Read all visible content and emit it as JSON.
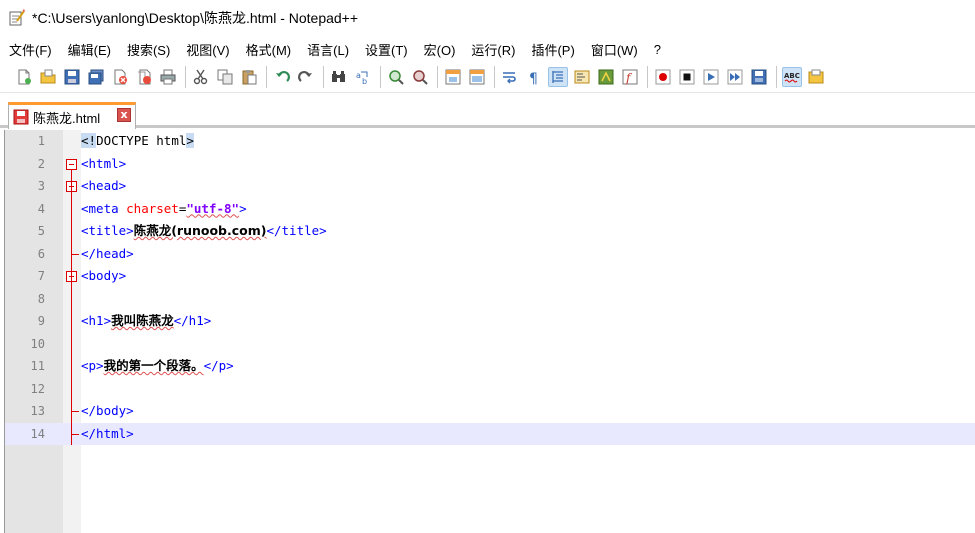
{
  "window": {
    "title": "*C:\\Users\\yanlong\\Desktop\\陈燕龙.html - Notepad++"
  },
  "menu": [
    "文件(F)",
    "编辑(E)",
    "搜索(S)",
    "视图(V)",
    "格式(M)",
    "语言(L)",
    "设置(T)",
    "宏(O)",
    "运行(R)",
    "插件(P)",
    "窗口(W)",
    "?"
  ],
  "toolbar": {
    "icons": [
      "new-file-icon",
      "open-file-icon",
      "save-icon",
      "save-all-icon",
      "close-icon",
      "close-all-icon",
      "print-icon",
      "cut-icon",
      "copy-icon",
      "paste-icon",
      "undo-icon",
      "redo-icon",
      "find-icon",
      "replace-icon",
      "zoom-in-icon",
      "zoom-out-icon",
      "sync-vertical-icon",
      "sync-horizontal-icon",
      "word-wrap-icon",
      "show-all-chars-icon",
      "indent-guide-icon",
      "document-map-icon",
      "function-list-icon",
      "folder-workspace-icon",
      "record-macro-icon",
      "stop-record-icon",
      "play-macro-icon",
      "run-macro-multiple-icon",
      "save-macro-icon",
      "spell-check-icon",
      "extra-icon"
    ],
    "abc_label": "ABC"
  },
  "tab": {
    "label": "陈燕龙.html",
    "close": "x"
  },
  "editor": {
    "lines": [
      {
        "n": "1",
        "parts": [
          [
            "hl",
            "<"
          ],
          [
            "hl-dt",
            "!"
          ],
          [
            "dt",
            "DOCTYPE html"
          ],
          [
            "hl",
            ">"
          ]
        ]
      },
      {
        "n": "2",
        "parts": [
          [
            "tag",
            "<html>"
          ]
        ]
      },
      {
        "n": "3",
        "parts": [
          [
            "tag",
            "<head>"
          ]
        ]
      },
      {
        "n": "4",
        "parts": [
          [
            "tag",
            "<meta "
          ],
          [
            "attr",
            "charset"
          ],
          [
            "dt",
            "="
          ],
          [
            "val",
            "\"utf-8\""
          ],
          [
            "tag",
            ">"
          ]
        ]
      },
      {
        "n": "5",
        "parts": [
          [
            "tag",
            "<title>"
          ],
          [
            "txt",
            "陈燕龙(runoob.com)"
          ],
          [
            "tag",
            "</title>"
          ]
        ]
      },
      {
        "n": "6",
        "parts": [
          [
            "tag",
            "</head>"
          ]
        ]
      },
      {
        "n": "7",
        "parts": [
          [
            "tag",
            "<body>"
          ]
        ]
      },
      {
        "n": "8",
        "parts": []
      },
      {
        "n": "9",
        "parts": [
          [
            "tag",
            "<h1>"
          ],
          [
            "txt",
            "我叫陈燕龙"
          ],
          [
            "tag",
            "</h1>"
          ]
        ]
      },
      {
        "n": "10",
        "parts": []
      },
      {
        "n": "11",
        "parts": [
          [
            "tag",
            "<p>"
          ],
          [
            "txt",
            "我的第一个段落。"
          ],
          [
            "tag",
            "</p>"
          ]
        ]
      },
      {
        "n": "12",
        "parts": []
      },
      {
        "n": "13",
        "parts": [
          [
            "tag",
            "</body>"
          ]
        ]
      },
      {
        "n": "14",
        "parts": [
          [
            "tag",
            "</html>"
          ]
        ]
      }
    ],
    "current_line": 14
  },
  "colors": {
    "tag": "#0000ff",
    "attr": "#ff0000",
    "value": "#8000ff",
    "current_line_bg": "#e8e8ff",
    "tab_accent": "#ff9a2e"
  }
}
